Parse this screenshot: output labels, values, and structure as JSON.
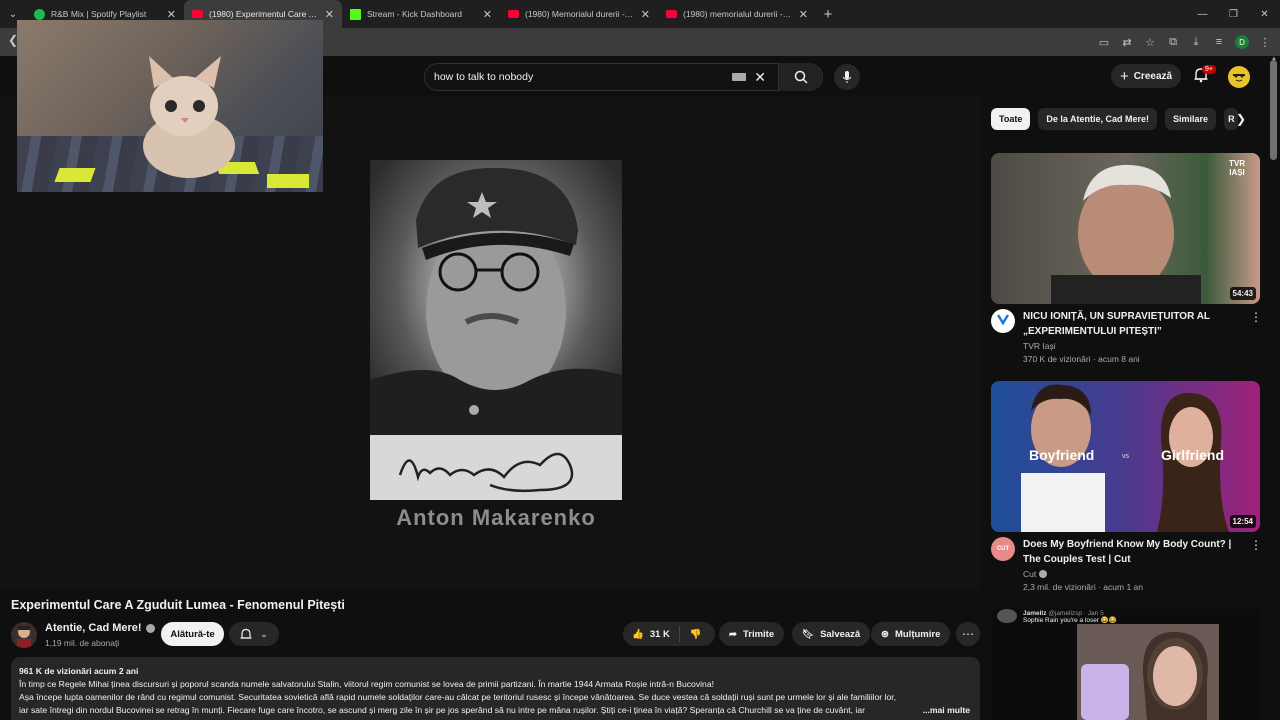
{
  "browser": {
    "tabs": [
      {
        "title": "R&B Mix | Spotify Playlist",
        "color": "#1db954",
        "active": false
      },
      {
        "title": "(1980) Experimentul Care A Zgu",
        "color": "#ff0033",
        "active": true
      },
      {
        "title": "Stream - Kick Dashboard",
        "color": "#53fc18",
        "active": false
      },
      {
        "title": "(1980) Memorialul durerii - You",
        "color": "#ff0033",
        "active": false
      },
      {
        "title": "(1980) memorialul durerii - You",
        "color": "#ff0033",
        "active": false
      }
    ],
    "profile_initial": "D"
  },
  "header": {
    "search_query": "how to talk to nobody",
    "create_label": "Creează",
    "notif_badge": "9+"
  },
  "player": {
    "caption": "Anton Makarenko"
  },
  "video": {
    "title": "Experimentul Care A Zguduit Lumea - Fenomenul Pitești",
    "channel": "Atentie, Cad Mere!",
    "subscribers": "1,19 mil. de abonați",
    "join_label": "Alătură-te",
    "likes": "31 K",
    "share_label": "Trimite",
    "save_label": "Salvează",
    "thanks_label": "Mulțumire",
    "meta": "961 K de vizionări  acum 2 ani",
    "desc_line1": "În timp ce Regele Mihai ținea discursuri și poporul scanda numele salvatorului Stalin, viitorul regim comunist se lovea de primii partizani. În martie 1944 Armata Roșie intră-n Bucovina!",
    "desc_line2": "Așa începe lupta oamenilor de rând cu regimul comunist. Securitatea sovietică află rapid numele soldaților care-au călcat pe teritoriul rusesc și începe vânătoarea. Se duce vestea că soldații ruși sunt pe urmele lor și ale familiilor lor,",
    "desc_line3": "iar sate întregi din nordul Bucovinei se retrag în munți. Fiecare fuge care încotro, se ascund și merg zile în șir pe jos sperând să nu intre pe mâna rușilor. Știți ce-i ținea în viață? Speranța că Churchill se va ține de cuvânt, iar",
    "more_label": "...mai multe"
  },
  "sidebar": {
    "chips": [
      "Toate",
      "De la Atentie, Cad Mere!",
      "Similare",
      "R"
    ],
    "videos": [
      {
        "title": "NICU IONIȚĂ, UN SUPRAVIEȚUITOR AL „EXPERIMENTULUI PITEȘTI”",
        "channel": "TVR Iași",
        "meta": "370 K de vizionări · acum 8 ani",
        "duration": "54:43",
        "watermark": "TVR IAȘI"
      },
      {
        "title": "Does My Boyfriend Know My Body Count? | The Couples Test | Cut",
        "channel": "Cut",
        "meta": "2,3 mil. de vizionări · acum 1 an",
        "duration": "12:54",
        "left_label": "Boyfriend",
        "vs_label": "vs",
        "right_label": "Girlfriend",
        "avatar_text": "CUT"
      },
      {
        "tweet_user": "Jamellz",
        "tweet_handle": "@jamellzsp · Jan 5",
        "tweet_text": "Sophie Rain you're a loser 😂😂"
      }
    ]
  }
}
